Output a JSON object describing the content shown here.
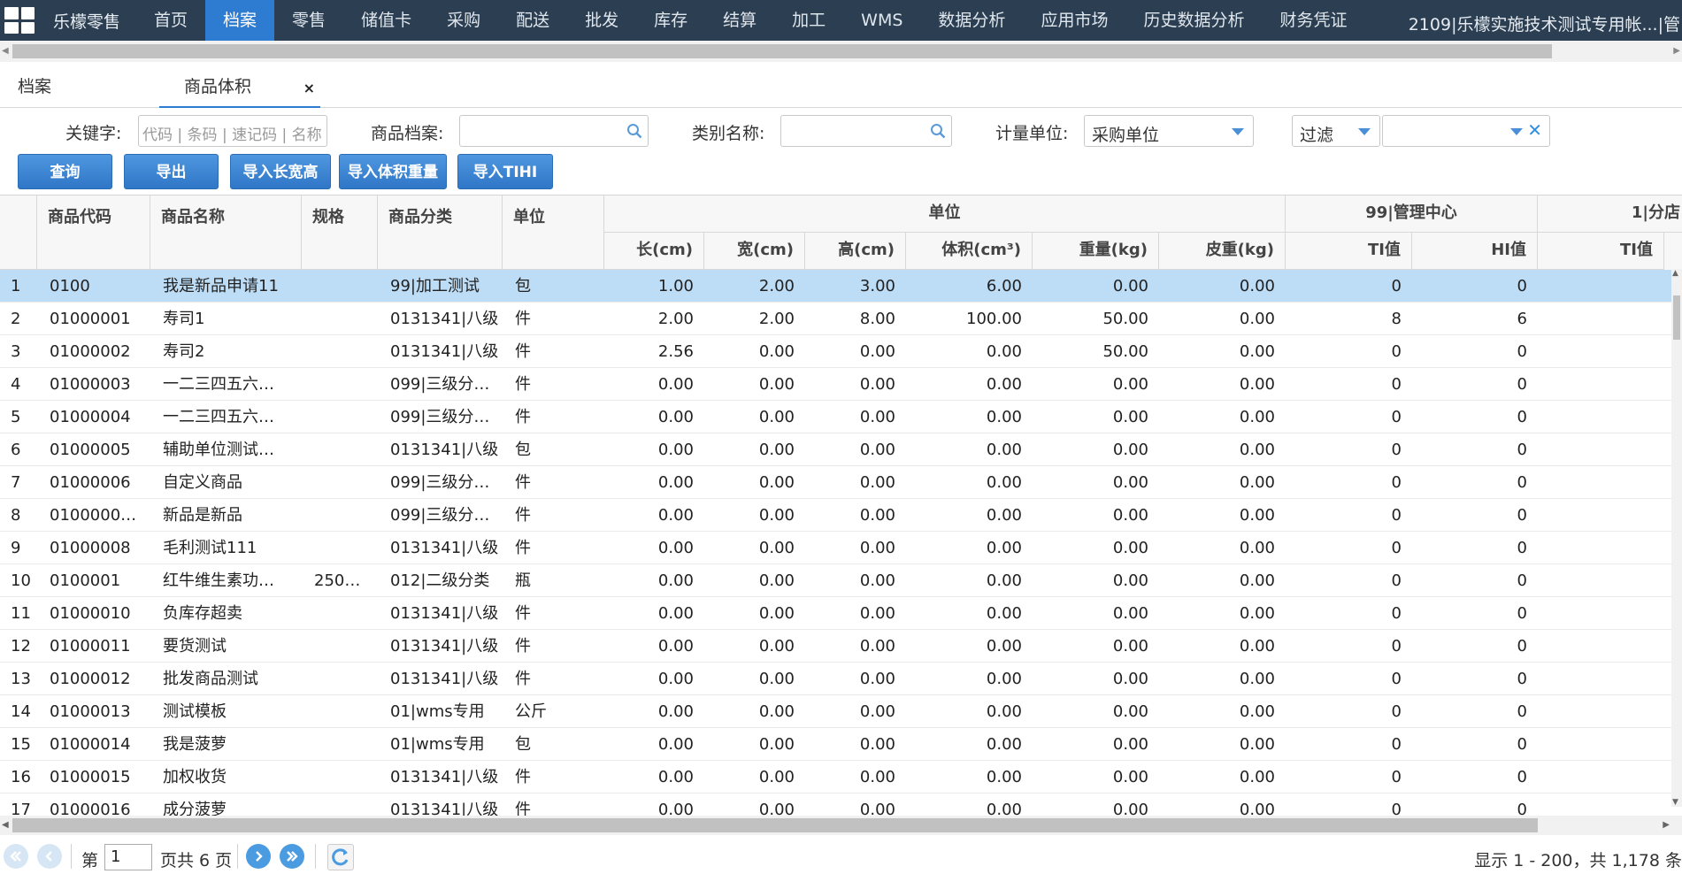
{
  "nav": {
    "brand": "乐檬零售",
    "items": [
      "首页",
      "档案",
      "零售",
      "储值卡",
      "采购",
      "配送",
      "批发",
      "库存",
      "结算",
      "加工",
      "WMS",
      "数据分析",
      "应用市场",
      "历史数据分析",
      "财务凭证"
    ],
    "active": "档案",
    "account": "2109|乐檬实施技术测试专用帐...|管"
  },
  "tabs": {
    "archive": "档案",
    "volume": "商品体积",
    "close": "×"
  },
  "filters": {
    "keyword_label": "关键字:",
    "keyword_placeholder": "代码 | 条码 | 速记码 | 名称",
    "product_label": "商品档案:",
    "category_label": "类别名称:",
    "unit_label": "计量单位:",
    "unit_value": "采购单位",
    "filter_value": "过滤"
  },
  "buttons": {
    "query": "查询",
    "export": "导出",
    "import_lwh": "导入长宽高",
    "import_volume_weight": "导入体积重量",
    "import_tihi": "导入TIHI"
  },
  "grid": {
    "headers": {
      "code": "商品代码",
      "name": "商品名称",
      "spec": "规格",
      "category": "商品分类",
      "unit": "单位",
      "unit_group": "单位",
      "length": "长(cm)",
      "width": "宽(cm)",
      "height": "高(cm)",
      "volume": "体积(cm³)",
      "weight": "重量(kg)",
      "tare": "皮重(kg)",
      "group_99": "99|管理中心",
      "ti_99": "TI值",
      "hi_99": "HI值",
      "group_1": "1|分店",
      "ti_1": "TI值"
    },
    "rows": [
      {
        "n": "1",
        "code": "0100",
        "name": "我是新品申请11",
        "spec": "",
        "cat": "99|加工测试",
        "unit": "包",
        "l": "1.00",
        "w": "2.00",
        "h": "3.00",
        "v": "6.00",
        "wt": "0.00",
        "tare": "0.00",
        "ti": "0",
        "hi": "0"
      },
      {
        "n": "2",
        "code": "01000001",
        "name": "寿司1",
        "spec": "",
        "cat": "0131341|八级",
        "unit": "件",
        "l": "2.00",
        "w": "2.00",
        "h": "8.00",
        "v": "100.00",
        "wt": "50.00",
        "tare": "0.00",
        "ti": "8",
        "hi": "6"
      },
      {
        "n": "3",
        "code": "01000002",
        "name": "寿司2",
        "spec": "",
        "cat": "0131341|八级",
        "unit": "件",
        "l": "2.56",
        "w": "0.00",
        "h": "0.00",
        "v": "0.00",
        "wt": "50.00",
        "tare": "0.00",
        "ti": "0",
        "hi": "0"
      },
      {
        "n": "4",
        "code": "01000003",
        "name": "一二三四五六…",
        "spec": "",
        "cat": "099|三级分…",
        "unit": "件",
        "l": "0.00",
        "w": "0.00",
        "h": "0.00",
        "v": "0.00",
        "wt": "0.00",
        "tare": "0.00",
        "ti": "0",
        "hi": "0"
      },
      {
        "n": "5",
        "code": "01000004",
        "name": "一二三四五六…",
        "spec": "",
        "cat": "099|三级分…",
        "unit": "件",
        "l": "0.00",
        "w": "0.00",
        "h": "0.00",
        "v": "0.00",
        "wt": "0.00",
        "tare": "0.00",
        "ti": "0",
        "hi": "0"
      },
      {
        "n": "6",
        "code": "01000005",
        "name": "辅助单位测试…",
        "spec": "",
        "cat": "0131341|八级",
        "unit": "包",
        "l": "0.00",
        "w": "0.00",
        "h": "0.00",
        "v": "0.00",
        "wt": "0.00",
        "tare": "0.00",
        "ti": "0",
        "hi": "0"
      },
      {
        "n": "7",
        "code": "01000006",
        "name": "自定义商品",
        "spec": "",
        "cat": "099|三级分…",
        "unit": "件",
        "l": "0.00",
        "w": "0.00",
        "h": "0.00",
        "v": "0.00",
        "wt": "0.00",
        "tare": "0.00",
        "ti": "0",
        "hi": "0"
      },
      {
        "n": "8",
        "code": "0100000…",
        "name": "新品是新品",
        "spec": "",
        "cat": "099|三级分…",
        "unit": "件",
        "l": "0.00",
        "w": "0.00",
        "h": "0.00",
        "v": "0.00",
        "wt": "0.00",
        "tare": "0.00",
        "ti": "0",
        "hi": "0"
      },
      {
        "n": "9",
        "code": "01000008",
        "name": "毛利测试111",
        "spec": "",
        "cat": "0131341|八级",
        "unit": "件",
        "l": "0.00",
        "w": "0.00",
        "h": "0.00",
        "v": "0.00",
        "wt": "0.00",
        "tare": "0.00",
        "ti": "0",
        "hi": "0"
      },
      {
        "n": "10",
        "code": "0100001",
        "name": "红牛维生素功…",
        "spec": "250…",
        "cat": "012|二级分类",
        "unit": "瓶",
        "l": "0.00",
        "w": "0.00",
        "h": "0.00",
        "v": "0.00",
        "wt": "0.00",
        "tare": "0.00",
        "ti": "0",
        "hi": "0"
      },
      {
        "n": "11",
        "code": "01000010",
        "name": "负库存超卖",
        "spec": "",
        "cat": "0131341|八级",
        "unit": "件",
        "l": "0.00",
        "w": "0.00",
        "h": "0.00",
        "v": "0.00",
        "wt": "0.00",
        "tare": "0.00",
        "ti": "0",
        "hi": "0"
      },
      {
        "n": "12",
        "code": "01000011",
        "name": "要货测试",
        "spec": "",
        "cat": "0131341|八级",
        "unit": "件",
        "l": "0.00",
        "w": "0.00",
        "h": "0.00",
        "v": "0.00",
        "wt": "0.00",
        "tare": "0.00",
        "ti": "0",
        "hi": "0"
      },
      {
        "n": "13",
        "code": "01000012",
        "name": "批发商品测试",
        "spec": "",
        "cat": "0131341|八级",
        "unit": "件",
        "l": "0.00",
        "w": "0.00",
        "h": "0.00",
        "v": "0.00",
        "wt": "0.00",
        "tare": "0.00",
        "ti": "0",
        "hi": "0"
      },
      {
        "n": "14",
        "code": "01000013",
        "name": "测试模板",
        "spec": "",
        "cat": "01|wms专用",
        "unit": "公斤",
        "l": "0.00",
        "w": "0.00",
        "h": "0.00",
        "v": "0.00",
        "wt": "0.00",
        "tare": "0.00",
        "ti": "0",
        "hi": "0"
      },
      {
        "n": "15",
        "code": "01000014",
        "name": "我是菠萝",
        "spec": "",
        "cat": "01|wms专用",
        "unit": "包",
        "l": "0.00",
        "w": "0.00",
        "h": "0.00",
        "v": "0.00",
        "wt": "0.00",
        "tare": "0.00",
        "ti": "0",
        "hi": "0"
      },
      {
        "n": "16",
        "code": "01000015",
        "name": "加权收货",
        "spec": "",
        "cat": "0131341|八级",
        "unit": "件",
        "l": "0.00",
        "w": "0.00",
        "h": "0.00",
        "v": "0.00",
        "wt": "0.00",
        "tare": "0.00",
        "ti": "0",
        "hi": "0"
      },
      {
        "n": "17",
        "code": "01000016",
        "name": "成分菠萝",
        "spec": "",
        "cat": "0131341|八级",
        "unit": "件",
        "l": "0.00",
        "w": "0.00",
        "h": "0.00",
        "v": "0.00",
        "wt": "0.00",
        "tare": "0.00",
        "ti": "0",
        "hi": "0"
      }
    ]
  },
  "pager": {
    "page_prefix": "第",
    "page_value": "1",
    "page_suffix": "页共 6 页",
    "summary": "显示 1 - 200，共 1,178 条"
  },
  "colors": {
    "nav_bg": "#2c3e52",
    "accent": "#2e7bd2",
    "selected_row": "#bddcf5"
  },
  "icons": [
    "grid-logo-icon",
    "search-icon",
    "chevron-down-icon",
    "clear-icon",
    "first-page-icon",
    "prev-page-icon",
    "next-page-icon",
    "last-page-icon",
    "refresh-icon"
  ]
}
